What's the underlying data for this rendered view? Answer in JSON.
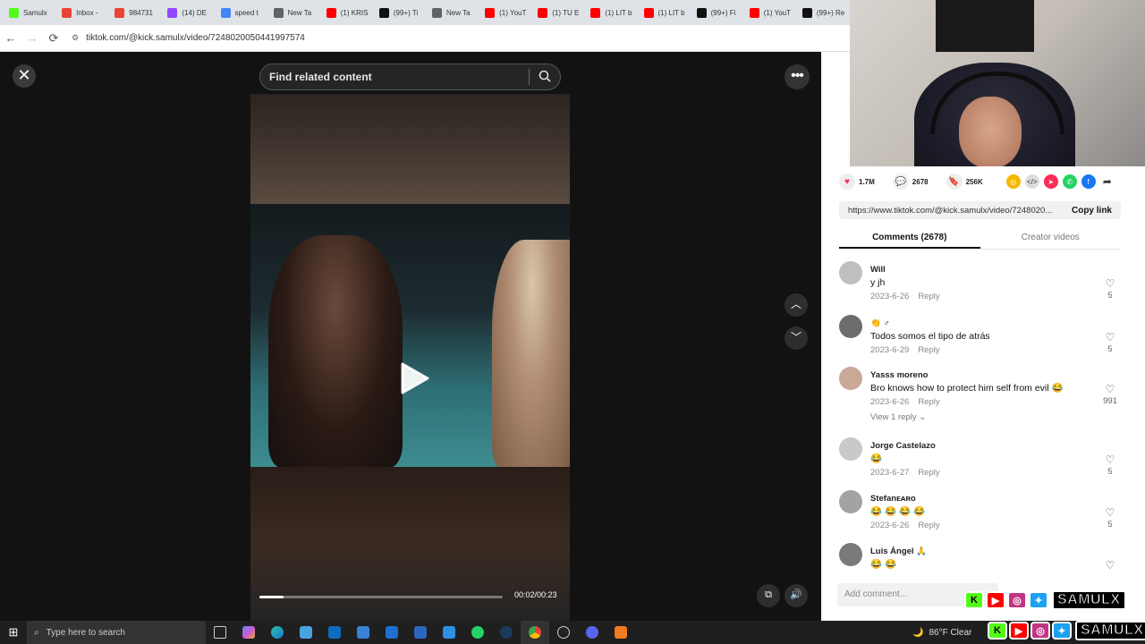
{
  "browser": {
    "tabs": [
      {
        "label": "Samulx",
        "icon": "kick-icon",
        "color": "#53fc18"
      },
      {
        "label": "Inbox -",
        "icon": "gmail-icon",
        "color": "#ea4335"
      },
      {
        "label": "984731",
        "icon": "gmail-icon",
        "color": "#ea4335"
      },
      {
        "label": "(14) DE",
        "icon": "twitch-icon",
        "color": "#9146ff"
      },
      {
        "label": "speed t",
        "icon": "google-icon",
        "color": "#4285f4"
      },
      {
        "label": "New Ta",
        "icon": "chrome-icon",
        "color": "#5f6368"
      },
      {
        "label": "(1) KRIS",
        "icon": "youtube-icon",
        "color": "#ff0000"
      },
      {
        "label": "(99+) Ti",
        "icon": "tiktok-icon",
        "color": "#111111"
      },
      {
        "label": "New Ta",
        "icon": "chrome-icon",
        "color": "#5f6368"
      },
      {
        "label": "(1) YouT",
        "icon": "youtube-icon",
        "color": "#ff0000"
      },
      {
        "label": "(1) TU E",
        "icon": "youtube-icon",
        "color": "#ff0000"
      },
      {
        "label": "(1) LIT b",
        "icon": "youtube-icon",
        "color": "#ff0000"
      },
      {
        "label": "(1) LIT b",
        "icon": "youtube-icon",
        "color": "#ff0000"
      },
      {
        "label": "(99+) Fi",
        "icon": "tiktok-icon",
        "color": "#111111"
      },
      {
        "label": "(1) YouT",
        "icon": "youtube-icon",
        "color": "#ff0000"
      },
      {
        "label": "(99+) Re",
        "icon": "tiktok-icon",
        "color": "#111111"
      }
    ],
    "url": "tiktok.com/@kick.samulx/video/7248020050441997574"
  },
  "video": {
    "search_placeholder": "Find related content",
    "time": "00:02/00:23",
    "progress": 0.1
  },
  "panel": {
    "likes": "1.7M",
    "comments_count": "2678",
    "saves": "256K",
    "share_link": "https://www.tiktok.com/@kick.samulx/video/7248020...",
    "copy_link": "Copy link",
    "tab_comments": "Comments (2678)",
    "tab_creator": "Creator videos",
    "add_comment_placeholder": "Add comment..."
  },
  "comments": [
    {
      "user": "Will",
      "text": "y jh",
      "date": "2023-6-26",
      "reply": "Reply",
      "likes": "5"
    },
    {
      "user": "👏 ♂",
      "text": "Todos somos el tipo de atrás",
      "date": "2023-6-29",
      "reply": "Reply",
      "likes": "5"
    },
    {
      "user": "Yasss moreno",
      "text": "Bro knows how to protect him self from evil 😂",
      "date": "2023-6-26",
      "reply": "Reply",
      "likes": "991",
      "view_replies": "View 1 reply ⌄"
    },
    {
      "user": "Jorge Castelazo",
      "text": "😂",
      "date": "2023-6-27",
      "reply": "Reply",
      "likes": "5"
    },
    {
      "user": "Stefanᴇᴀʀᴏ",
      "text": "😂 😂 😂 😂",
      "date": "2023-6-26",
      "reply": "Reply",
      "likes": "5"
    },
    {
      "user": "Luis Ángel 🙏",
      "text": "😂 😂",
      "date": "",
      "reply": "",
      "likes": ""
    }
  ],
  "overlay": {
    "brand": "SAMULX"
  },
  "taskbar": {
    "search_placeholder": "Type here to search",
    "weather": "86°F  Clear"
  },
  "colors": {
    "like_red": "#fe2c55",
    "kick_green": "#53fc18"
  }
}
